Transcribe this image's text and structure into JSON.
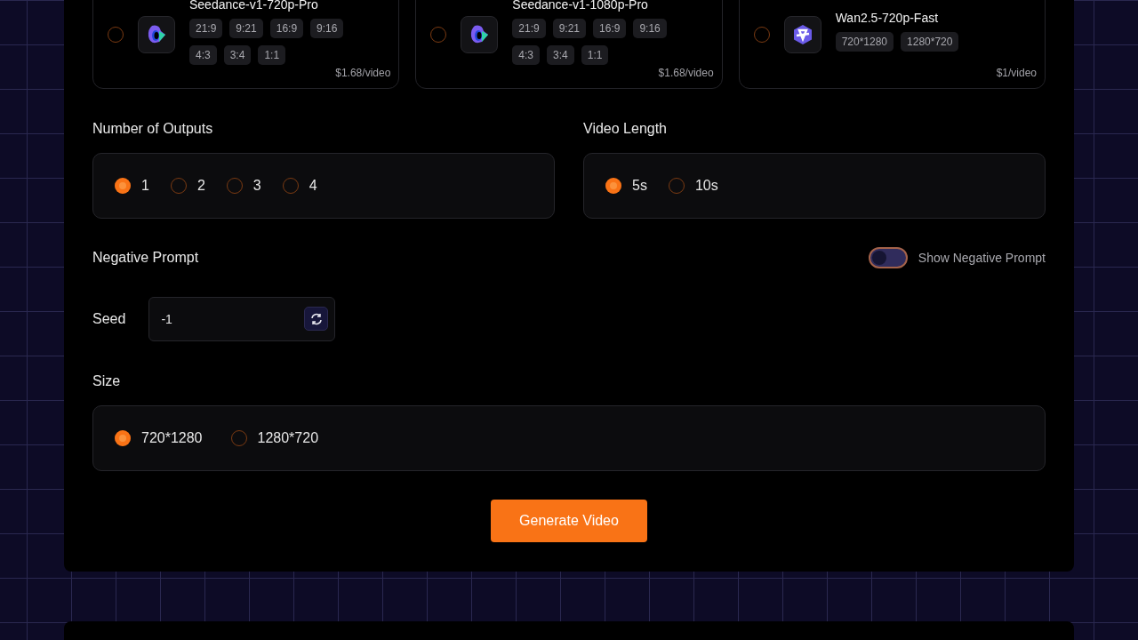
{
  "models": [
    {
      "name": "Seedance-v1-720p-Pro",
      "selected": false,
      "kind": "seedance",
      "options": [
        "21:9",
        "9:21",
        "16:9",
        "9:16",
        "4:3",
        "3:4",
        "1:1"
      ],
      "price": "$1.68/video"
    },
    {
      "name": "Seedance-v1-1080p-Pro",
      "selected": false,
      "kind": "seedance",
      "options": [
        "21:9",
        "9:21",
        "16:9",
        "9:16",
        "4:3",
        "3:4",
        "1:1"
      ],
      "price": "$1.68/video"
    },
    {
      "name": "Wan2.5-720p-Fast",
      "selected": false,
      "kind": "wan",
      "options": [
        "720*1280",
        "1280*720"
      ],
      "price": "$1/video"
    }
  ],
  "outputs": {
    "label": "Number of Outputs",
    "options": [
      {
        "label": "1",
        "selected": true
      },
      {
        "label": "2",
        "selected": false
      },
      {
        "label": "3",
        "selected": false
      },
      {
        "label": "4",
        "selected": false
      }
    ]
  },
  "length": {
    "label": "Video Length",
    "options": [
      {
        "label": "5s",
        "selected": true
      },
      {
        "label": "10s",
        "selected": false
      }
    ]
  },
  "negative_prompt": {
    "label": "Negative Prompt",
    "toggle_label": "Show Negative Prompt",
    "on": false
  },
  "seed": {
    "label": "Seed",
    "value": "-1"
  },
  "size": {
    "label": "Size",
    "options": [
      {
        "label": "720*1280",
        "selected": true
      },
      {
        "label": "1280*720",
        "selected": false
      }
    ]
  },
  "generate_button": "Generate Video"
}
